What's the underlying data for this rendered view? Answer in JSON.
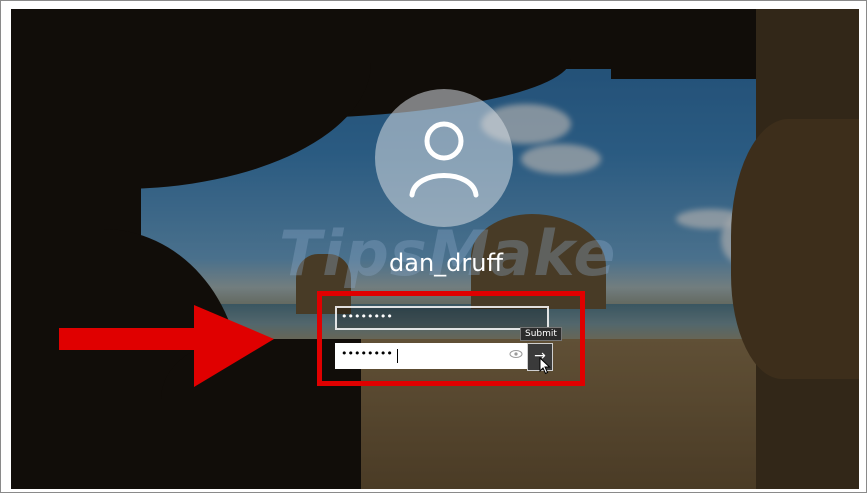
{
  "login": {
    "username": "dan_druff",
    "password_field_1_value": "••••••••",
    "password_field_2_value": "••••••••",
    "submit_tooltip": "Submit",
    "submit_glyph": "→",
    "reveal_glyph": "👁"
  },
  "watermark": {
    "text": "TipsMake"
  },
  "annotation": {
    "highlight_color": "#e00000",
    "arrow_color": "#e00000"
  },
  "icons": {
    "avatar": "user-icon",
    "submit": "arrow-right-icon",
    "reveal": "eye-icon",
    "cursor": "mouse-pointer-icon"
  }
}
